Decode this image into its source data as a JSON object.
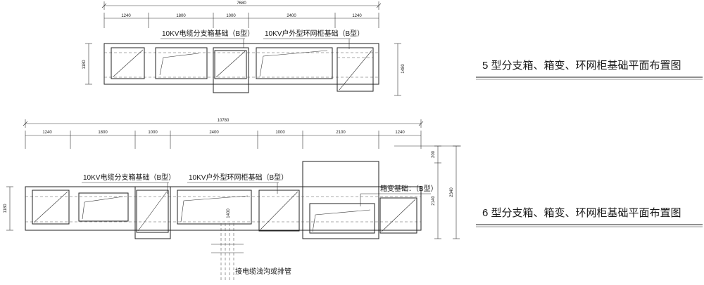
{
  "plan5": {
    "title": "5 型分支箱、箱变、环网柜基础平面布置图",
    "total_dim": "7680",
    "segment_dims": [
      "1240",
      "1800",
      "1000",
      "2400",
      "1240"
    ],
    "label_branch_box": "10KV电缆分支箱基础（B型）",
    "label_ring_main": "10KV户外型环网柜基础（B型）",
    "dim_left_height": "1180",
    "dim_right_height": "1480"
  },
  "plan6": {
    "title": "6 型分支箱、箱变、环网柜基础平面布置图",
    "total_dim": "10780",
    "segment_dims": [
      "1240",
      "1800",
      "1000",
      "2400",
      "1000",
      "2100",
      "1240"
    ],
    "label_branch_box": "10KV电缆分支箱基础（B型）",
    "label_ring_main": "10KV户外型环网柜基础（B型）",
    "label_box_transformer": "箱变基础：（B型）",
    "dim_left_height": "1180",
    "dim_right_200": "200",
    "dim_right_2140": "2140",
    "dim_right_2340": "2340",
    "dim_1400": "1400",
    "label_cable": "接电缆浅沟或排管"
  }
}
